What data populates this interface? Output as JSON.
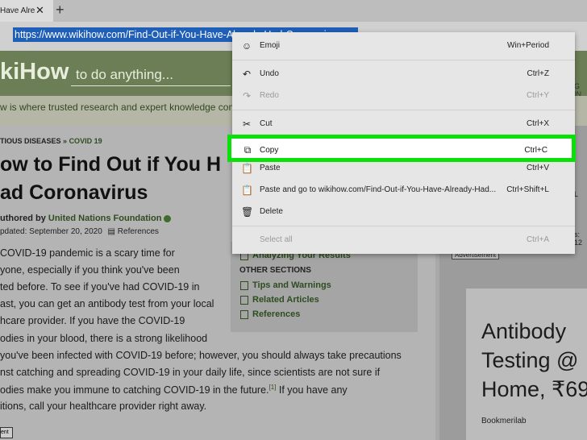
{
  "browser": {
    "tab_title": "Have Alre",
    "tab_close": "✕",
    "new_tab": "+",
    "url": "https://www.wikihow.com/Find-Out-if-You-Have-Already-Had-Coronavirus"
  },
  "page": {
    "logo": "kiHow",
    "search_placeholder": "to do anything...",
    "header_right": "G IN",
    "tagline": "w is where trusted research and expert knowledge come",
    "breadcrumb": {
      "parent": "TIOUS DISEASES",
      "sep": "»",
      "current": "COVID 19"
    },
    "title_line1": "ow to Find Out if You H",
    "title_line2": "ad Coronavirus",
    "author_prefix": "uthored by ",
    "author_name": "United Nations Foundation",
    "updated": "pdated: September 20, 2020",
    "references_link": "References",
    "paragraph": [
      "COVID-19 pandemic is a scary time for",
      "yone, especially if you think you've been",
      "ted before. To see if you've had COVID-19 in",
      "ast, you can get an antibody test from your local",
      "hcare provider. If you have the COVID-19",
      "odies in your blood, there is a strong likelihood",
      "you've been infected with COVID-19 before; however, you should always take precautions",
      "nst catching and spreading COVID-19 in your daily life, since scientists are not sure if",
      "odies make you immune to catching COVID-19 in the future.",
      " If you have any",
      "itions, call your healthcare provider right away."
    ],
    "citation": "[1]",
    "ad_corner": "ent",
    "toc": {
      "item_top": "Analyzing Your Results",
      "other_heading": "OTHER SECTIONS",
      "items": [
        "Tips and Warnings",
        "Related Articles",
        "References"
      ]
    },
    "sidebar": {
      "label1": "L",
      "label2": "s: 12",
      "ad_label": "Advertisement",
      "ad_title": "Antibody\nTesting @\nHome, ₹69",
      "ad_brand": "Bookmerilab"
    }
  },
  "context_menu": {
    "items": [
      {
        "icon": "emoji-icon",
        "glyph": "☺",
        "label": "Emoji",
        "shortcut": "Win+Period",
        "disabled": false
      },
      {
        "icon": "undo-icon",
        "glyph": "↶",
        "label": "Undo",
        "shortcut": "Ctrl+Z",
        "disabled": false
      },
      {
        "icon": "redo-icon",
        "glyph": "↷",
        "label": "Redo",
        "shortcut": "Ctrl+Y",
        "disabled": true
      },
      {
        "icon": "cut-icon",
        "glyph": "✂",
        "label": "Cut",
        "shortcut": "Ctrl+X",
        "disabled": false
      },
      {
        "icon": "copy-icon",
        "glyph": "⧉",
        "label": "Copy",
        "shortcut": "Ctrl+C",
        "disabled": false,
        "highlighted": true
      },
      {
        "icon": "paste-icon",
        "glyph": "📋",
        "label": "Paste",
        "shortcut": "Ctrl+V",
        "disabled": false
      },
      {
        "icon": "paste-go-icon",
        "glyph": "📋",
        "label": "Paste and go to wikihow.com/Find-Out-if-You-Have-Already-Had...",
        "shortcut": "Ctrl+Shift+L",
        "disabled": false
      },
      {
        "icon": "delete-icon",
        "glyph": "🗑",
        "label": "Delete",
        "shortcut": "",
        "disabled": false
      },
      {
        "icon": "",
        "glyph": "",
        "label": "Select all",
        "shortcut": "Ctrl+A",
        "disabled": true
      }
    ],
    "highlight_color": "#0be00b"
  }
}
